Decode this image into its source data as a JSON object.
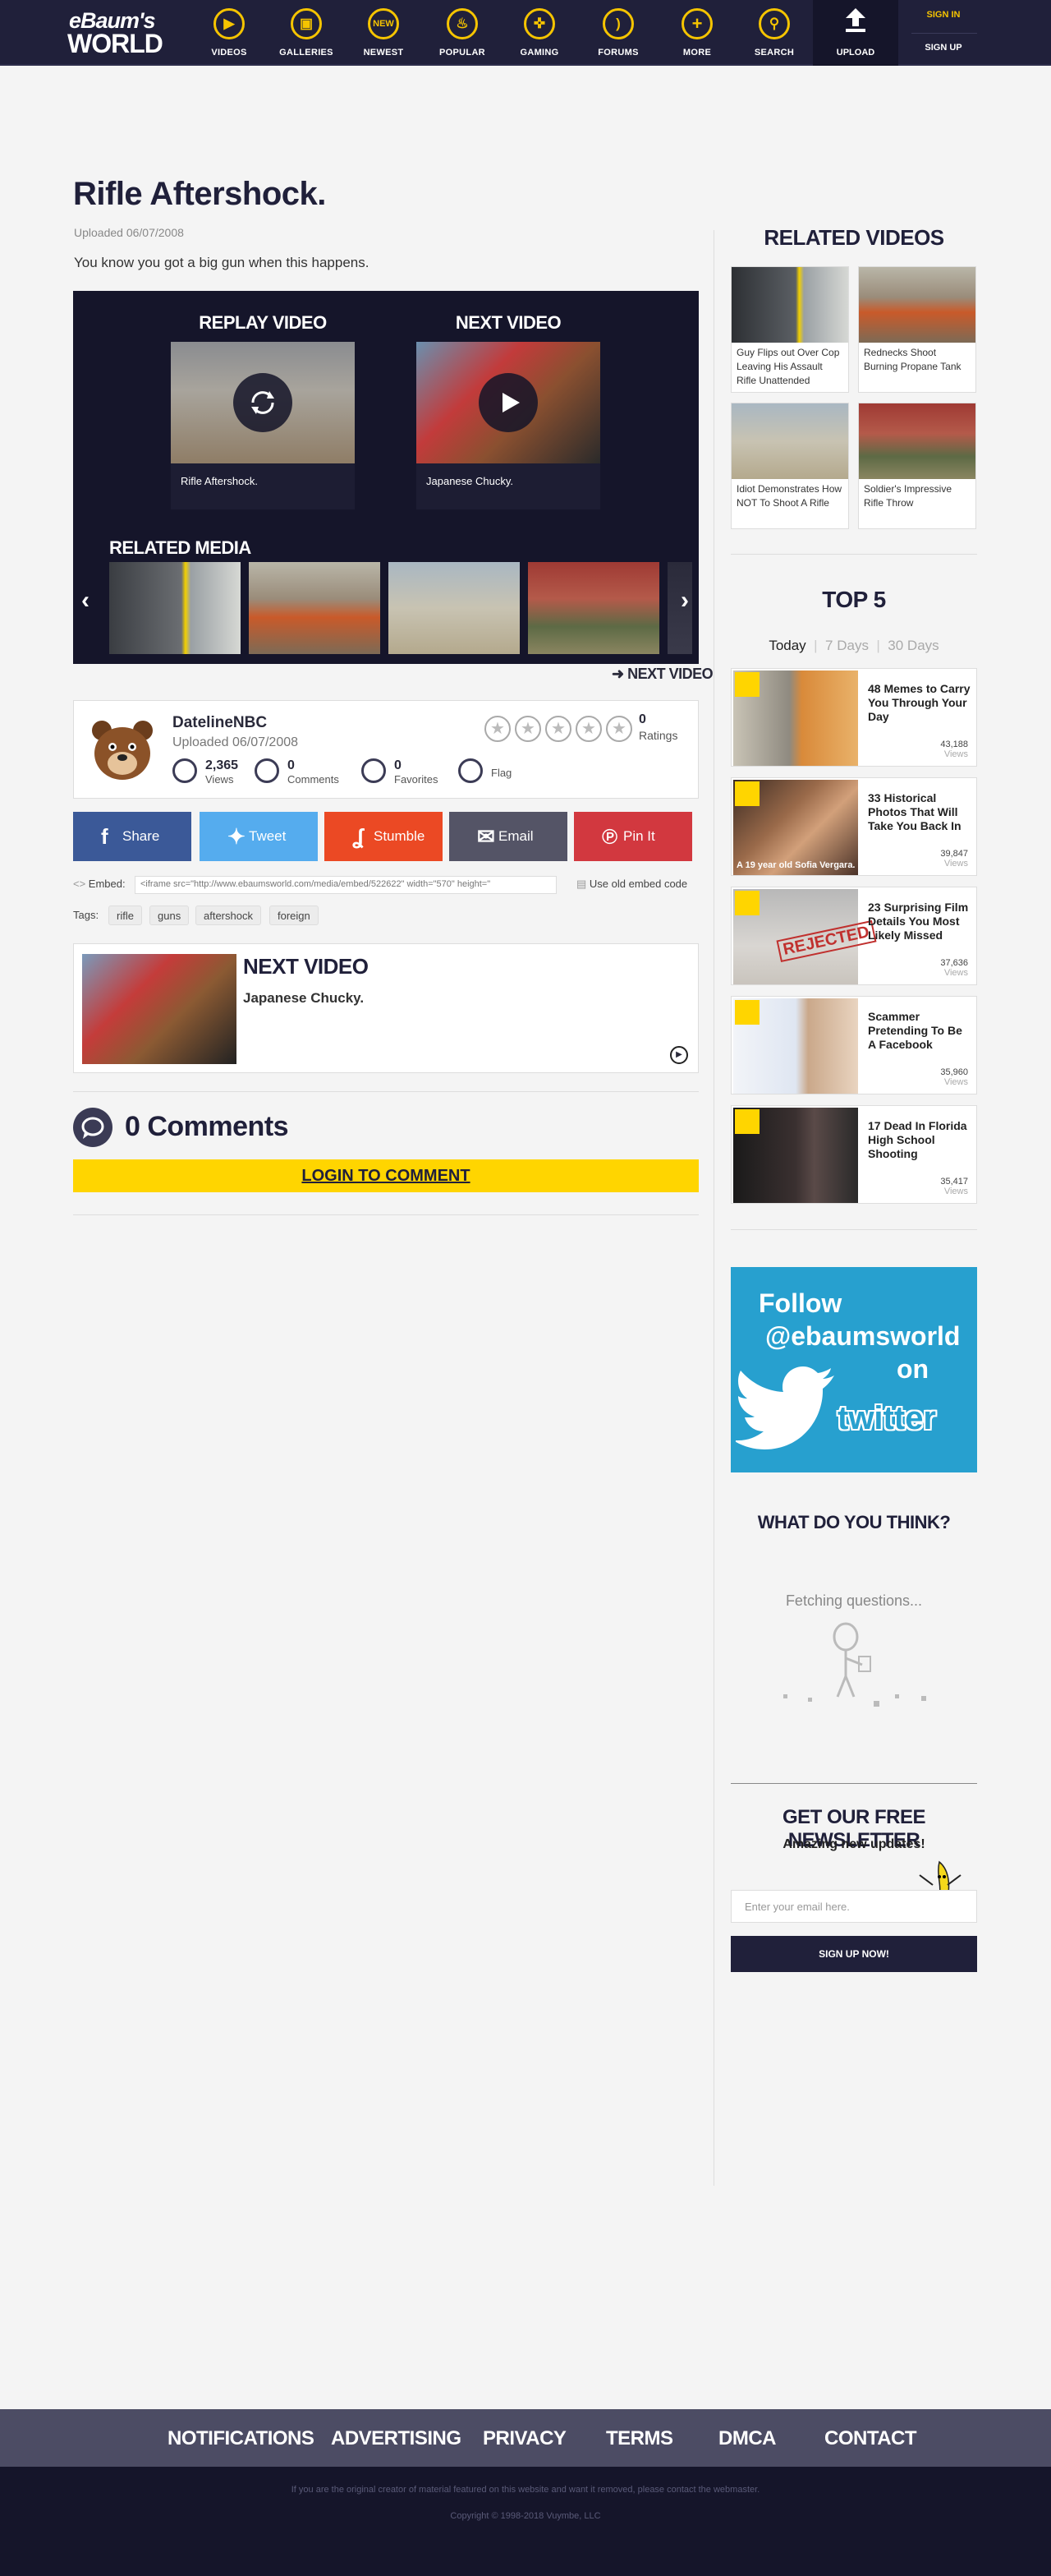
{
  "nav": {
    "logo_top": "eBaum's",
    "logo_bottom": "WORLD",
    "items": [
      {
        "label": "VIDEOS",
        "icon": "play-icon",
        "glyph": "▶"
      },
      {
        "label": "GALLERIES",
        "icon": "gallery-icon",
        "glyph": "▣"
      },
      {
        "label": "NEWEST",
        "icon": "new-icon",
        "glyph": "NEW"
      },
      {
        "label": "POPULAR",
        "icon": "fire-icon",
        "glyph": "♨"
      },
      {
        "label": "GAMING",
        "icon": "gamepad-icon",
        "glyph": "✜"
      },
      {
        "label": "FORUMS",
        "icon": "banana-icon",
        "glyph": ")"
      },
      {
        "label": "MORE",
        "icon": "plus-icon",
        "glyph": "+"
      },
      {
        "label": "SEARCH",
        "icon": "search-icon",
        "glyph": "⚲"
      }
    ],
    "upload": "UPLOAD",
    "sign_in": "SIGN IN",
    "sign_up": "SIGN UP"
  },
  "video": {
    "title": "Rifle Aftershock.",
    "uploaded": "Uploaded 06/07/2008",
    "description": "You know you got a big gun when this happens."
  },
  "player": {
    "replay_title": "REPLAY VIDEO",
    "replay_caption": "Rifle Aftershock.",
    "next_title": "NEXT VIDEO",
    "next_caption": "Japanese Chucky.",
    "related_media": "RELATED MEDIA"
  },
  "next_video_link": "NEXT VIDEO",
  "uploader": {
    "name": "DatelineNBC",
    "date": "Uploaded 06/07/2008",
    "views": "2,365",
    "views_label": "Views",
    "comments": "0",
    "comments_label": "Comments",
    "favorites": "0",
    "favorites_label": "Favorites",
    "flag_label": "Flag",
    "ratings": "0",
    "ratings_label": "Ratings"
  },
  "share": [
    {
      "label": "Share",
      "icon": "facebook-icon",
      "glyph": "f",
      "color": "#3b5998"
    },
    {
      "label": "Tweet",
      "icon": "twitter-icon",
      "glyph": "✦",
      "color": "#55acee"
    },
    {
      "label": "Stumble",
      "icon": "stumbleupon-icon",
      "glyph": "ʆ",
      "color": "#eb4924"
    },
    {
      "label": "Email",
      "icon": "email-icon",
      "glyph": "✉",
      "color": "#545466"
    },
    {
      "label": "Pin It",
      "icon": "pinterest-icon",
      "glyph": "℗",
      "color": "#d2383f"
    }
  ],
  "embed": {
    "label": "Embed:",
    "code": "<iframe src=\"http://www.ebaumsworld.com/media/embed/522622\" width=\"570\" height=\"",
    "old_label": "Use old embed code"
  },
  "tags": {
    "label": "Tags:",
    "items": [
      "rifle",
      "guns",
      "aftershock",
      "foreign"
    ]
  },
  "next_box": {
    "heading": "NEXT VIDEO",
    "title": "Japanese Chucky."
  },
  "comments": {
    "title": "0 Comments",
    "login": "LOGIN TO COMMENT"
  },
  "sidebar": {
    "related_title": "RELATED VIDEOS",
    "related": [
      "Guy Flips out Over Cop Leaving His Assault Rifle Unattended",
      "Rednecks Shoot Burning Propane Tank",
      "Idiot Demonstrates How NOT To Shoot A Rifle",
      "Soldier's Impressive Rifle Throw"
    ],
    "top5_title": "TOP 5",
    "tabs": [
      "Today",
      "7 Days",
      "30 Days"
    ],
    "top5": [
      {
        "title": "48 Memes to Carry You Through Your Day",
        "views": "43,188"
      },
      {
        "title": "33 Historical Photos That Will Take You Back In",
        "views": "39,847"
      },
      {
        "title": "23 Surprising Film Details You Most Likely Missed",
        "views": "37,636"
      },
      {
        "title": "Scammer Pretending To Be A Facebook",
        "views": "35,960"
      },
      {
        "title": "17 Dead In Florida High School Shooting",
        "views": "35,417"
      }
    ],
    "views_label": "Views",
    "top5_overlay": "A 19 year old Sofia Vergara.",
    "rejected": "REJECTED",
    "twitter": {
      "line1": "Follow",
      "line2": "@ebaumsworld",
      "line3": "on",
      "line4": "twitter"
    },
    "wdyt_title": "WHAT DO YOU THINK?",
    "fetching": "Fetching questions...",
    "newsletter_title": "GET OUR FREE NEWSLETTER",
    "newsletter_sub": "Amazing new updates!",
    "email_placeholder": "Enter your email here.",
    "signup_button": "SIGN UP NOW!"
  },
  "footer": {
    "links": [
      "NOTIFICATIONS",
      "ADVERTISING",
      "PRIVACY",
      "TERMS",
      "DMCA",
      "CONTACT"
    ],
    "notice": "If you are the original creator of material featured on this website and want it removed, please contact the webmaster.",
    "copyright": "Copyright © 1998-2018 Vuymbe, LLC"
  },
  "colors": {
    "brand_yellow": "#f5c400",
    "nav_bg": "#20203a",
    "login_yellow": "#ffd500",
    "twitter_blue": "#27a0cf"
  }
}
